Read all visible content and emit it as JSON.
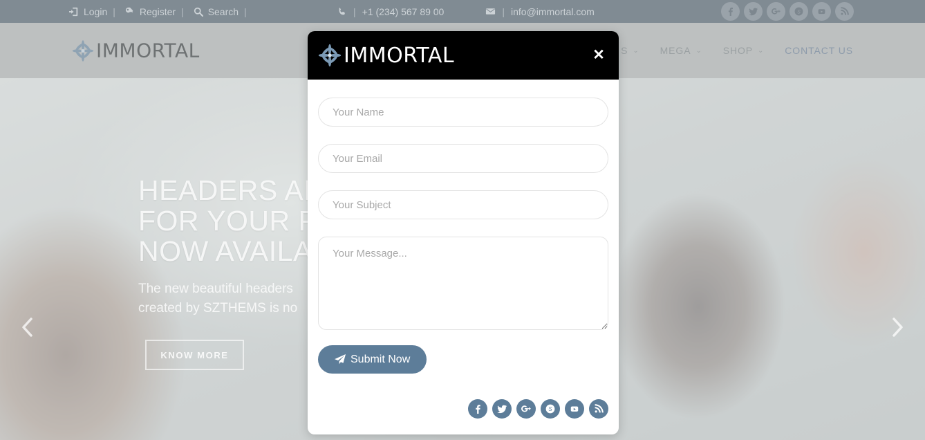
{
  "topbar": {
    "links": [
      {
        "label": "Login",
        "icon": "login-icon"
      },
      {
        "label": "Register",
        "icon": "key-icon"
      },
      {
        "label": "Search",
        "icon": "search-icon"
      }
    ],
    "separator": "|",
    "phone": {
      "icon": "phone-icon",
      "bar": "|",
      "value": "+1 (234) 567 89 00"
    },
    "email": {
      "icon": "envelope-icon",
      "bar": "|",
      "value": "info@immortal.com"
    },
    "social": [
      "facebook",
      "twitter",
      "google-plus",
      "skype",
      "youtube",
      "rss"
    ]
  },
  "navbar": {
    "logo_text": "IMMORTAL",
    "items": [
      {
        "label": "S",
        "caret": "⌄",
        "active": false
      },
      {
        "label": "MEGA",
        "caret": "⌄",
        "active": false
      },
      {
        "label": "SHOP",
        "caret": "⌄",
        "active": false
      },
      {
        "label": "CONTACT US",
        "caret": "",
        "active": true
      }
    ]
  },
  "hero": {
    "title": "HEADERS AND\nFOR YOUR P\nNOW AVAILA",
    "subtitle": "The new beautiful headers\ncreated by SZTHEMS is no",
    "cta_label": "KNOW MORE",
    "prev_label": "previous-slide",
    "next_label": "next-slide"
  },
  "modal": {
    "logo_text": "IMMORTAL",
    "close_label": "✕",
    "form": {
      "name_placeholder": "Your Name",
      "name_value": "",
      "email_placeholder": "Your Email",
      "email_value": "",
      "subject_placeholder": "Your Subject",
      "subject_value": "",
      "message_placeholder": "Your Message...",
      "message_value": "",
      "submit_label": "Submit Now"
    },
    "social": [
      "facebook",
      "twitter",
      "google-plus",
      "skype",
      "youtube",
      "rss"
    ]
  },
  "colors": {
    "topbar_bg": "#808b93",
    "nav_bg": "#bdc0c0",
    "modal_header_bg": "#000000",
    "accent": "#5d7d99",
    "logo_mark": "#7b9ab5"
  }
}
